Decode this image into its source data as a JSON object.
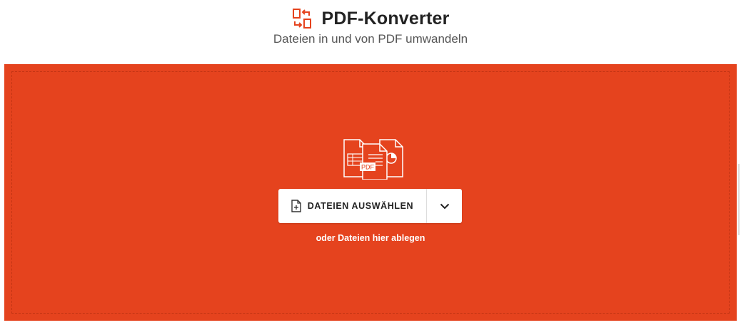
{
  "header": {
    "title": "PDF-Konverter",
    "subtitle": "Dateien in und von PDF umwandeln",
    "icon": "convert-arrows-icon"
  },
  "dropzone": {
    "illustration_label": "PDF",
    "choose_files_label": "DATEIEN AUSWÄHLEN",
    "choose_icon": "file-add-icon",
    "dropdown_icon": "chevron-down-icon",
    "drop_hint": "oder Dateien hier ablegen"
  },
  "colors": {
    "accent": "#e5431e",
    "title_text": "#222222",
    "subtitle_text": "#555555",
    "button_bg": "#ffffff"
  }
}
